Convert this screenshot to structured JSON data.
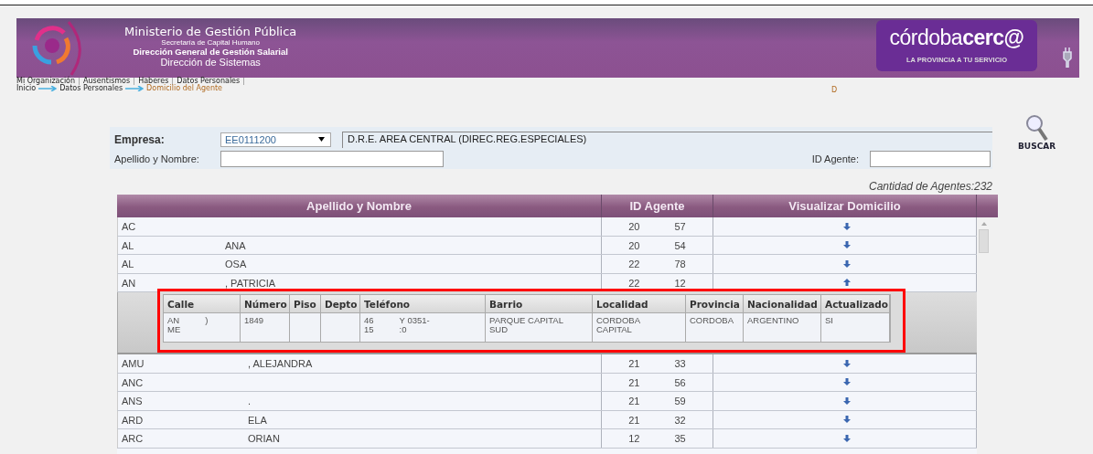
{
  "header": {
    "lines": [
      "Ministerio de Gestión Pública",
      "Secretaría de Capital Humano",
      "Dirección General de Gestión Salarial",
      "Dirección de Sistemas"
    ],
    "brand_light": "córdoba",
    "brand_bold": "cerc@",
    "brand_tagline": "LA PROVINCIA A TU SERVICIO"
  },
  "nav": [
    "Mi Organización",
    "Ausentismos",
    "Haberes",
    "Datos Personales"
  ],
  "breadcrumb": [
    {
      "label": "Inicio",
      "selected": false
    },
    {
      "label": "Datos Personales",
      "selected": false
    },
    {
      "label": "Domicilio del Agente",
      "selected": true
    }
  ],
  "user_label": "D",
  "form": {
    "empresa_label": "Empresa:",
    "empresa_value": "EE0111200",
    "empresa_desc": "D.R.E. AREA CENTRAL (DIREC.REG.ESPECIALES)",
    "nombre_label": "Apellido y Nombre:",
    "id_label": "ID Agente:",
    "search_button": "BUSCAR"
  },
  "count": "Cantidad de Agentes:232",
  "table": {
    "columns": [
      "Apellido y Nombre",
      "ID Agente",
      "Visualizar Domicilio"
    ],
    "rows": [
      {
        "name": [
          "AC"
        ],
        "id": [
          "20",
          "57"
        ],
        "expanded": false
      },
      {
        "name": [
          "AL",
          "ANA"
        ],
        "id": [
          "20",
          "54"
        ],
        "expanded": false
      },
      {
        "name": [
          "AL",
          "OSA"
        ],
        "id": [
          "22",
          "78"
        ],
        "expanded": false
      },
      {
        "name": [
          "AN",
          ", PATRICIA"
        ],
        "id": [
          "22",
          "12"
        ],
        "expanded": true,
        "detail": {
          "columns": [
            "Calle",
            "Número",
            "Piso",
            "Depto",
            "Teléfono",
            "Barrio",
            "Localidad",
            "Provincia",
            "Nacionalidad",
            "Actualizado"
          ],
          "cells": [
            [
              [
                "AN",
                ")"
              ],
              [
                "ME"
              ]
            ],
            [
              [
                "1849"
              ]
            ],
            [],
            [],
            [
              [
                "46",
                "Y 0351-"
              ],
              [
                "15",
                ":0"
              ]
            ],
            [
              [
                "PARQUE CAPITAL"
              ],
              [
                "SUD"
              ]
            ],
            [
              [
                "CORDOBA"
              ],
              [
                "CAPITAL"
              ]
            ],
            [
              [
                "CORDOBA"
              ]
            ],
            [
              [
                "ARGENTINO"
              ]
            ],
            [
              [
                "SI"
              ]
            ]
          ]
        }
      },
      {
        "name": [
          "AMU",
          ", ALEJANDRA"
        ],
        "id": [
          "21",
          "33"
        ],
        "expanded": false
      },
      {
        "name": [
          "ANC"
        ],
        "id": [
          "21",
          "56"
        ],
        "expanded": false
      },
      {
        "name": [
          "ANS",
          "."
        ],
        "id": [
          "21",
          "59"
        ],
        "expanded": false
      },
      {
        "name": [
          "ARD",
          "ELA"
        ],
        "id": [
          "21",
          "32"
        ],
        "expanded": false
      },
      {
        "name": [
          "ARC",
          "ORIAN"
        ],
        "id": [
          "12",
          "35"
        ],
        "expanded": false
      }
    ]
  }
}
